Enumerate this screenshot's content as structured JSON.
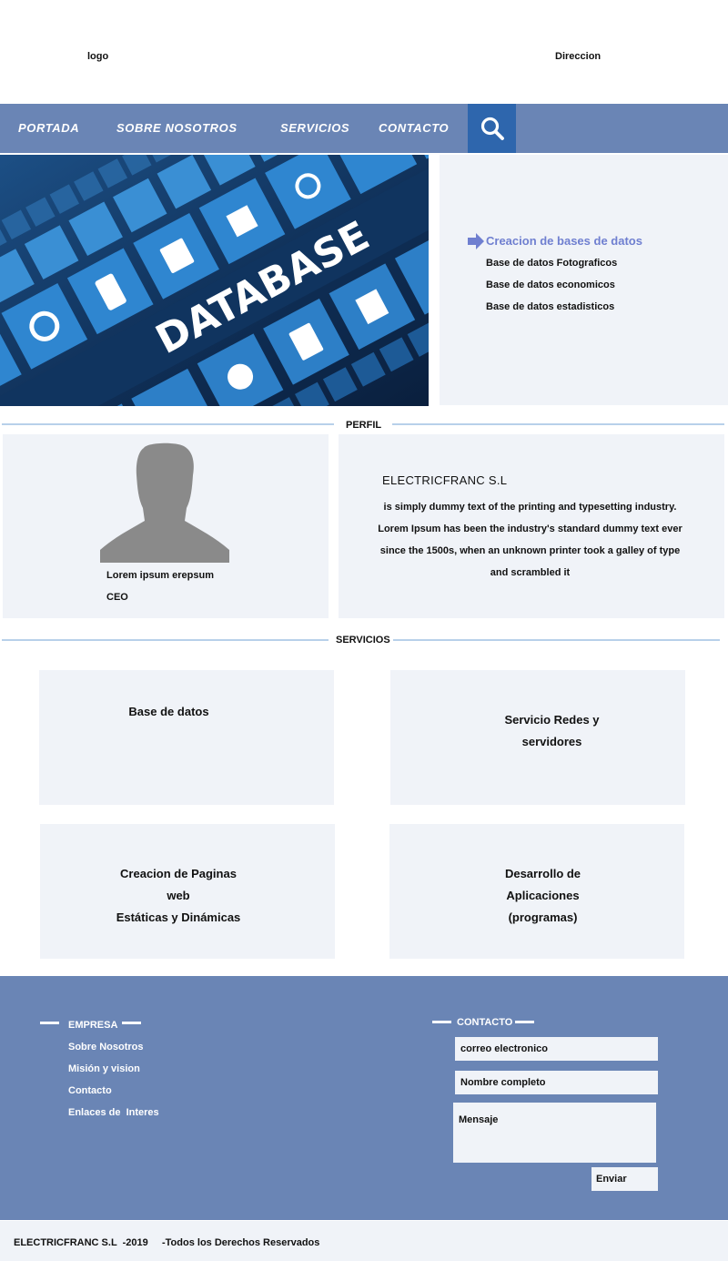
{
  "header": {
    "logo": "logo",
    "address": "Direccion"
  },
  "nav": {
    "items": [
      "PORTADA",
      "SOBRE NOSOTROS",
      "SERVICIOS",
      "CONTACTO"
    ],
    "search_icon": "search-icon"
  },
  "hero": {
    "image_text": "DATABASE",
    "title": "Creacion de bases de datos",
    "items": [
      "Base de datos Fotograficos",
      "Base de datos economicos",
      "Base de datos estadisticos"
    ]
  },
  "perfil": {
    "label": "PERFIL",
    "name": "Lorem ipsum erepsum",
    "role": "CEO",
    "company": "ELECTRICFRANC S.L",
    "description_lines": [
      "is simply dummy text of the printing and typesetting industry.",
      "Lorem Ipsum has been the industry's standard dummy text ever",
      "since the 1500s, when an unknown printer took a galley of type",
      "and scrambled it"
    ]
  },
  "servicios": {
    "label": "SERVICIOS",
    "boxes": [
      {
        "lines": [
          "Base de datos"
        ]
      },
      {
        "lines": [
          "Servicio Redes y",
          "servidores"
        ]
      },
      {
        "lines": [
          "Creacion de Paginas",
          "web",
          "Estáticas y Dinámicas"
        ]
      },
      {
        "lines": [
          "Desarrollo de",
          "Aplicaciones",
          "(programas)"
        ]
      }
    ]
  },
  "footer": {
    "empresa_heading": "EMPRESA",
    "links": [
      "Sobre Nosotros",
      "Misión y vision",
      "Contacto",
      "Enlaces de  Interes"
    ],
    "contacto_heading": "CONTACTO",
    "email_placeholder": "correo electronico",
    "name_placeholder": "Nombre completo",
    "message_placeholder": "Mensaje",
    "send_label": "Enviar",
    "copyright": "ELECTRICFRANC S.L  -2019     -Todos los Derechos Reservados"
  },
  "colors": {
    "nav_bg": "#6a85b5",
    "search_bg": "#2e66ad",
    "panel_bg": "#f0f3f8",
    "accent_title": "#6f7fd0",
    "divider": "#b8d0ea"
  }
}
